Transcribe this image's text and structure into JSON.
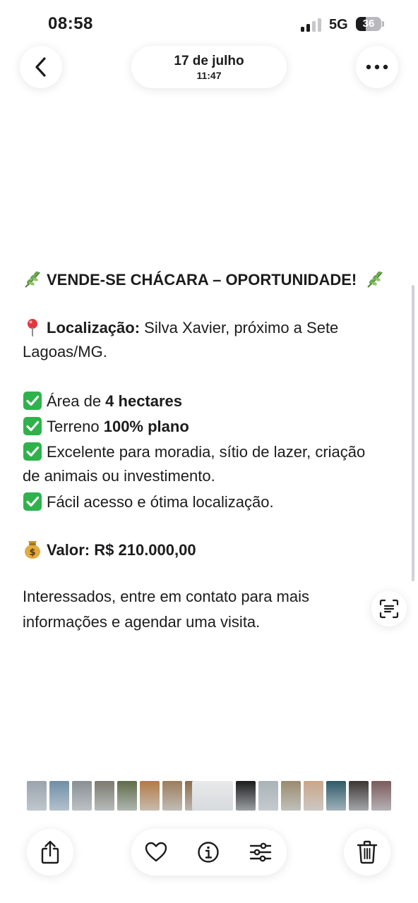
{
  "status_bar": {
    "time": "08:58",
    "network": "5G",
    "battery": "36"
  },
  "header": {
    "date": "17 de julho",
    "time": "11:47"
  },
  "post": {
    "title": "VENDE-SE CHÁCARA – OPORTUNIDADE!",
    "location_label": "Localização:",
    "location_value_1": " Silva Xavier, próximo a Sete",
    "location_value_2": "Lagoas/MG.",
    "area_prefix": "Área de ",
    "area_value": "4 hectares",
    "terrain_prefix": "Terreno ",
    "terrain_value": "100% plano",
    "excellent_1": "Excelente para moradia, sítio de lazer, criação",
    "excellent_2": "de animais ou investimento.",
    "access": "Fácil acesso e ótima localização.",
    "price": "Valor: R$ 210.000,00",
    "contact_1": "Interessados, entre em contato para mais",
    "contact_2": "informações e agendar uma visita."
  },
  "icons": {
    "back": "chevron-left-icon",
    "more": "ellipsis-icon",
    "scan_text": "live-text-icon",
    "share": "share-icon",
    "favorite": "heart-icon",
    "info": "info-icon",
    "adjust": "sliders-icon",
    "delete": "trash-icon"
  },
  "colors": {
    "check_green": "#2fb24c",
    "leaf_green": "#6aa84f",
    "text": "#1c1c1e"
  },
  "thumbnails": [
    "#9aa4ad",
    "#6f8fa8",
    "#8a8f94",
    "#7b7a6e",
    "#5f6b49",
    "#b27a45",
    "#9c7d5c",
    "#8d6c4a",
    "#e9e9e9",
    "#1b1b1b",
    "#a9b3b8",
    "#9a8b6e",
    "#c9a68a",
    "#2e5a68",
    "#3c3533",
    "#7a5b5b"
  ]
}
